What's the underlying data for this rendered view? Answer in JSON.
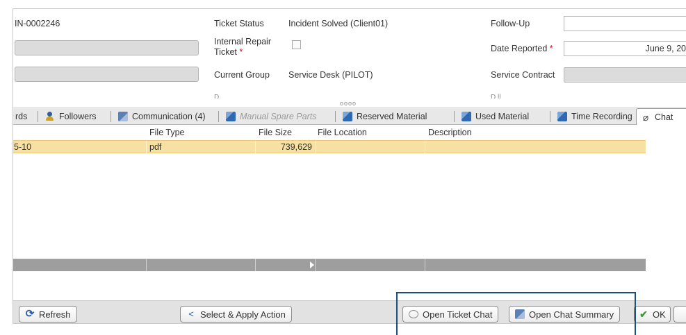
{
  "header": {
    "ticket_id": "IN-0002246",
    "ticket_status_label": "Ticket Status",
    "ticket_status_value": "Incident Solved (Client01)",
    "internal_repair_label_1": "Internal Repair",
    "internal_repair_label_2": "Ticket",
    "current_group_label": "Current Group",
    "current_group_value": "Service Desk (PILOT)",
    "follow_up_label": "Follow-Up",
    "follow_up_value": "",
    "date_reported_label": "Date Reported",
    "date_reported_value": "June 9, 20",
    "service_contract_label": "Service Contract",
    "service_contract_value": "",
    "required_mark": "*",
    "cutoff_left_label": "D",
    "cutoff_right_label": "D          ll"
  },
  "tabs": [
    {
      "label": "rds"
    },
    {
      "label": "Followers",
      "icon": "person-icon"
    },
    {
      "label": "Communication (4)",
      "icon": "document-icon"
    },
    {
      "label": "Manual Spare Parts",
      "icon": "module-icon",
      "disabled": true
    },
    {
      "label": "Reserved Material",
      "icon": "module-icon"
    },
    {
      "label": "Used Material",
      "icon": "module-icon"
    },
    {
      "label": "Time Recording",
      "icon": "module-icon"
    },
    {
      "label": "Chat",
      "icon": "paperclip-icon",
      "active": true
    }
  ],
  "splitter_grip": "oooo",
  "grid": {
    "columns": [
      "File Type",
      "File Size",
      "File Location",
      "Description"
    ],
    "rows": [
      {
        "name": "5-10",
        "file_type": "pdf",
        "file_size": "739,629",
        "file_location": "",
        "description": ""
      }
    ]
  },
  "toolbar": {
    "refresh_label": "Refresh",
    "select_apply_label": "Select & Apply Action",
    "open_ticket_chat_label": "Open Ticket Chat",
    "open_chat_summary_label": "Open Chat Summary",
    "ok_label": "OK"
  },
  "colors": {
    "selected_row": "#f7e0a4",
    "highlight_frame": "#1d4f7c",
    "required_mark": "#c8102e"
  }
}
